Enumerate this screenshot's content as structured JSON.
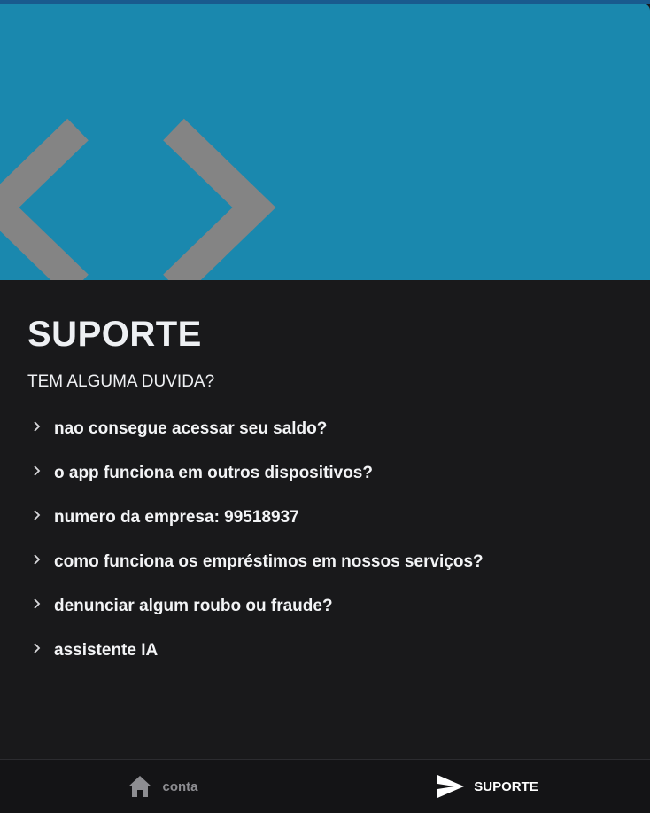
{
  "colors": {
    "hero_background": "#1a88ae",
    "top_strip": "#195a8e",
    "page_background": "#19191b",
    "code_icon": "#848484",
    "nav_inactive": "#8d8d91",
    "nav_active": "#ffffff"
  },
  "hero": {
    "icon": "code-brackets-icon"
  },
  "support": {
    "title": "SUPORTE",
    "subtitle": "TEM ALGUMA DUVIDA?",
    "faq": [
      {
        "label": "nao consegue acessar seu saldo?"
      },
      {
        "label": "o app funciona em outros dispositivos?"
      },
      {
        "label": "numero da empresa: 99518937"
      },
      {
        "label": "como funciona os empréstimos em nossos serviços?"
      },
      {
        "label": "denunciar algum roubo ou fraude?"
      },
      {
        "label": "assistente IA"
      }
    ]
  },
  "nav": {
    "items": [
      {
        "label": "conta",
        "icon": "home-icon",
        "active": false
      },
      {
        "label": "SUPORTE",
        "icon": "send-icon",
        "active": true
      }
    ]
  }
}
